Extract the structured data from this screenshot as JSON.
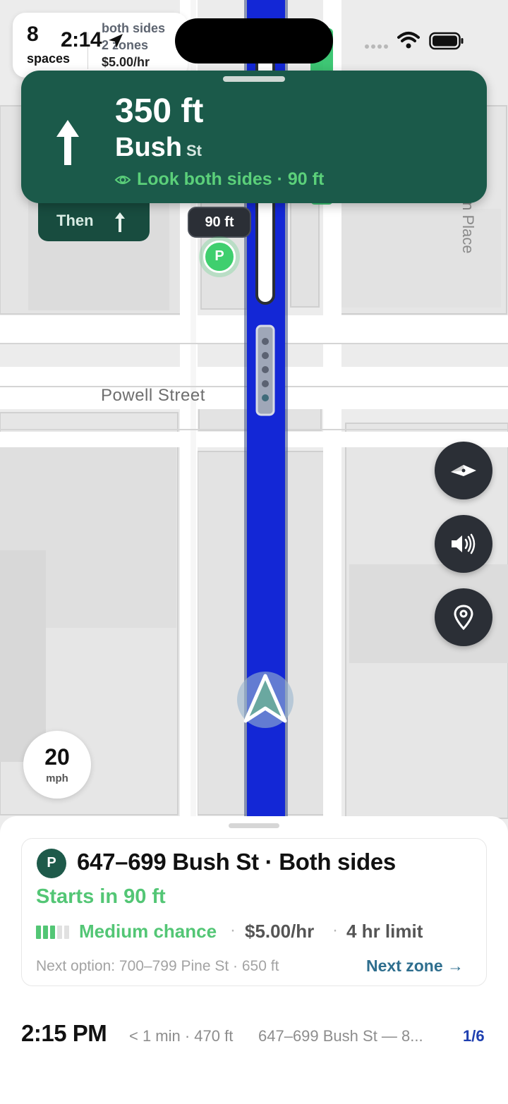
{
  "status_bar": {
    "time": "2:14"
  },
  "parking_summary": {
    "count": "8",
    "count_label": "spaces",
    "line1": "both sides",
    "line2": "2 zones",
    "price": "$5.00/hr"
  },
  "nav_banner": {
    "distance": "350 ft",
    "street_name": "Bush",
    "street_suffix": "St",
    "hint": "Look both sides · 90 ft",
    "then_label": "Then"
  },
  "map": {
    "distance_pill": "90 ft",
    "parking_marker": "P",
    "street_label": "Powell Street",
    "side_street_label": "Anson Place",
    "route_color": "#1327d6"
  },
  "controls": {
    "buttons": [
      {
        "name": "compass-button",
        "icon": "compass-icon"
      },
      {
        "name": "sound-button",
        "icon": "speaker-icon"
      },
      {
        "name": "location-button",
        "icon": "location-pin-icon"
      }
    ]
  },
  "speed": {
    "value": "20",
    "unit": "mph"
  },
  "zone_card": {
    "badge": "P",
    "title": "647–699 Bush St · Both sides",
    "starts": "Starts in 90 ft",
    "chance_level": 3,
    "chance_total": 5,
    "chance_label": "Medium chance",
    "separator": "·",
    "price": "$5.00/hr",
    "limit": "4 hr limit",
    "next_option": "Next option: 700–799 Pine St · 650 ft",
    "next_zone": "Next zone →"
  },
  "trip": {
    "eta": "2:15 PM",
    "meta": "< 1 min · 470 ft",
    "address": "647–699 Bush St — 8...",
    "page": "1/6"
  }
}
